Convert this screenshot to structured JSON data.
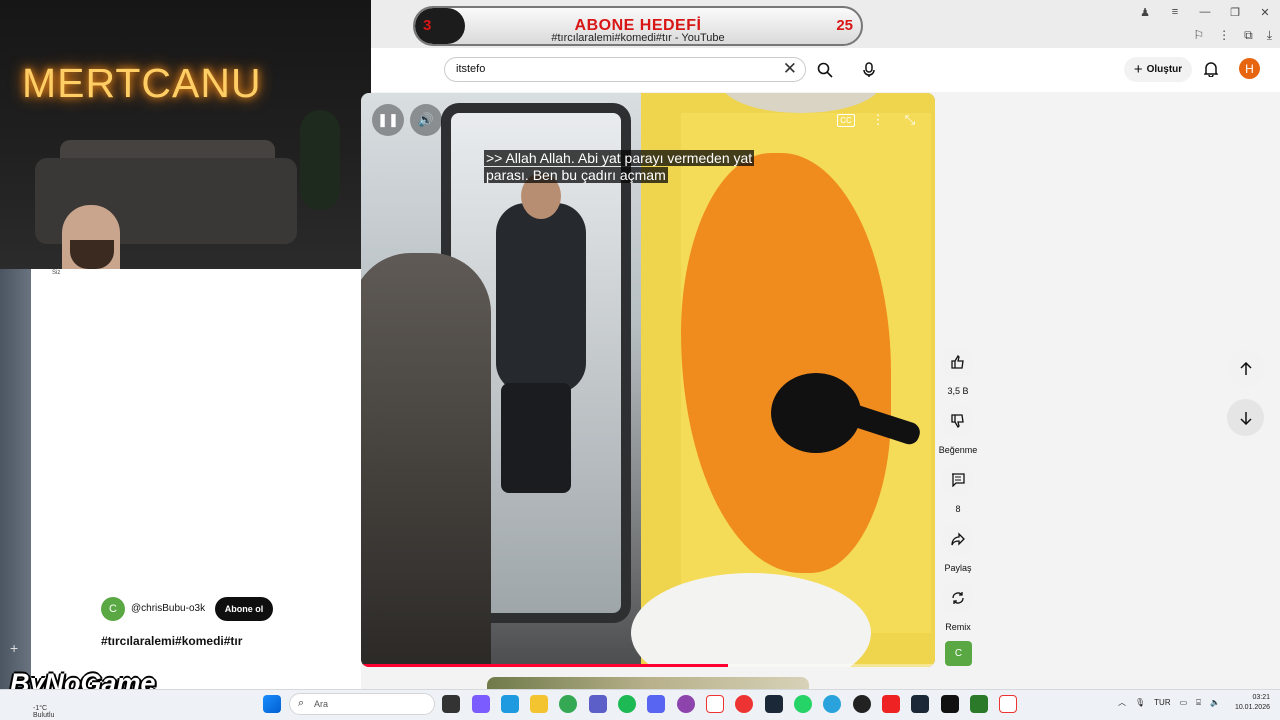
{
  "overlay": {
    "streamer_name": "MERTCANU",
    "goal_current": "3",
    "goal_title": "ABONE HEDEFİ",
    "goal_target": "25",
    "webcam_caption": "Siz",
    "watermark": "ByNoGame"
  },
  "browser": {
    "tab_title": "#tırcılaralemi#komedi#tır - YouTube"
  },
  "youtube": {
    "search_value": "itstefo",
    "create_label": "Oluştur",
    "avatar_letter": "H",
    "channel_letter": "C",
    "channel_handle": "@chrisBubu-o3k",
    "subscribe_label": "Abone ol",
    "hashtags": "#tırcılaralemi#komedi#tır",
    "caption_line1": ">> Allah Allah. Abi yat parayı vermeden yat",
    "caption_line2": "parası. Ben bu çadırı açmam",
    "progress": 0.64,
    "actions": {
      "like_count": "3,5 B",
      "dislike_label": "Beğenme",
      "comment_count": "8",
      "share_label": "Paylaş",
      "remix_label": "Remix"
    },
    "channel_thumb_letter": "C"
  },
  "taskbar": {
    "weather_line1": "-1°C",
    "weather_line2": "Bulutlu",
    "search_placeholder": "Ara",
    "language": "TUR",
    "time": "03:21",
    "date": "10.01.2026"
  }
}
